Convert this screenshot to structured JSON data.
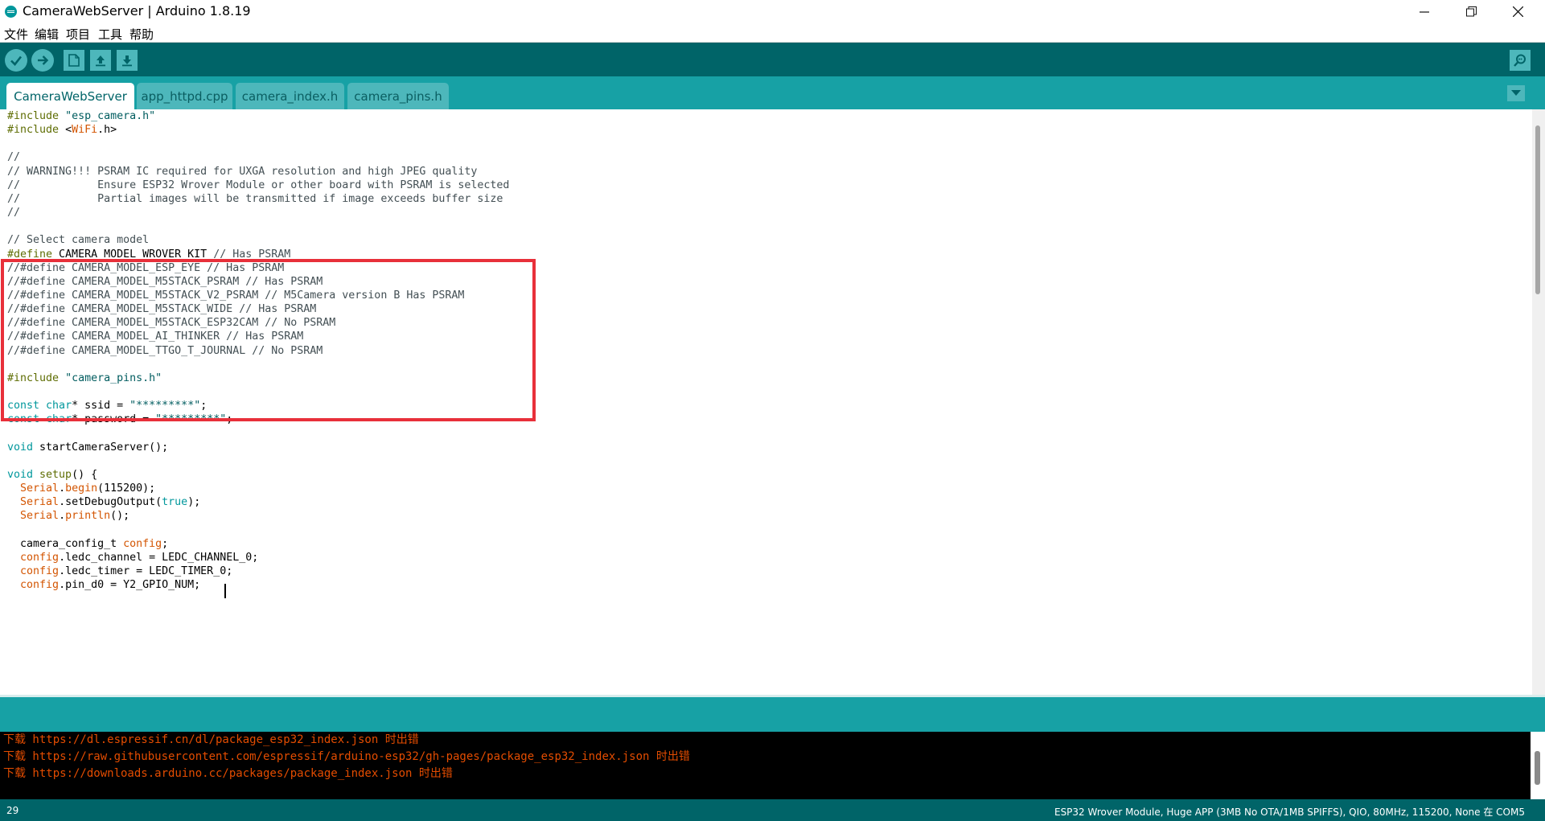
{
  "window": {
    "title": "CameraWebServer | Arduino 1.8.19"
  },
  "menu": {
    "items": [
      "文件",
      "编辑",
      "项目",
      "工具",
      "帮助"
    ]
  },
  "toolbar": {
    "buttons": [
      "verify-icon",
      "upload-icon",
      "new-icon",
      "open-icon",
      "save-icon"
    ],
    "right_button": "serial-monitor-icon"
  },
  "tabs": [
    {
      "label": "CameraWebServer",
      "active": true
    },
    {
      "label": "app_httpd.cpp",
      "active": false
    },
    {
      "label": "camera_index.h",
      "active": false
    },
    {
      "label": "camera_pins.h",
      "active": false
    }
  ],
  "editor": {
    "highlight_color": "#e8303a",
    "lines": [
      [
        [
          "pre",
          "#include "
        ],
        [
          "str",
          "\"esp_camera.h\""
        ]
      ],
      [
        [
          "pre",
          "#include "
        ],
        [
          "plain",
          "<"
        ],
        [
          "kw",
          "WiFi"
        ],
        [
          "plain",
          ".h>"
        ]
      ],
      [],
      [
        [
          "comment",
          "//"
        ]
      ],
      [
        [
          "comment",
          "// WARNING!!! PSRAM IC required for UXGA resolution and high JPEG quality"
        ]
      ],
      [
        [
          "comment",
          "//            Ensure ESP32 Wrover Module or other board with PSRAM is selected"
        ]
      ],
      [
        [
          "comment",
          "//            Partial images will be transmitted if image exceeds buffer size"
        ]
      ],
      [
        [
          "comment",
          "//"
        ]
      ],
      [],
      [
        [
          "comment",
          "// Select camera model"
        ]
      ],
      [
        [
          "pre",
          "#define "
        ],
        [
          "plain",
          "CAMERA_MODEL_WROVER_KIT "
        ],
        [
          "comment",
          "// Has PSRAM"
        ]
      ],
      [
        [
          "comment",
          "//#define CAMERA_MODEL_ESP_EYE // Has PSRAM"
        ]
      ],
      [
        [
          "comment",
          "//#define CAMERA_MODEL_M5STACK_PSRAM // Has PSRAM"
        ]
      ],
      [
        [
          "comment",
          "//#define CAMERA_MODEL_M5STACK_V2_PSRAM // M5Camera version B Has PSRAM"
        ]
      ],
      [
        [
          "comment",
          "//#define CAMERA_MODEL_M5STACK_WIDE // Has PSRAM"
        ]
      ],
      [
        [
          "comment",
          "//#define CAMERA_MODEL_M5STACK_ESP32CAM // No PSRAM"
        ]
      ],
      [
        [
          "comment",
          "//#define CAMERA_MODEL_AI_THINKER // Has PSRAM"
        ]
      ],
      [
        [
          "comment",
          "//#define CAMERA_MODEL_TTGO_T_JOURNAL // No PSRAM"
        ]
      ],
      [],
      [
        [
          "pre",
          "#include "
        ],
        [
          "str",
          "\"camera_pins.h\""
        ]
      ],
      [],
      [
        [
          "type",
          "const "
        ],
        [
          "type",
          "char"
        ],
        [
          "plain",
          "* ssid = "
        ],
        [
          "str",
          "\"*********\""
        ],
        [
          "plain",
          ";"
        ]
      ],
      [
        [
          "type",
          "const "
        ],
        [
          "type",
          "char"
        ],
        [
          "plain",
          "* password = "
        ],
        [
          "str",
          "\"*********\""
        ],
        [
          "plain",
          ";"
        ]
      ],
      [],
      [
        [
          "type",
          "void "
        ],
        [
          "plain",
          "startCameraServer();"
        ]
      ],
      [],
      [
        [
          "type",
          "void "
        ],
        [
          "pre",
          "setup"
        ],
        [
          "plain",
          "() {"
        ]
      ],
      [
        [
          "plain",
          "  "
        ],
        [
          "kw",
          "Serial"
        ],
        [
          "plain",
          "."
        ],
        [
          "kw",
          "begin"
        ],
        [
          "plain",
          "(115200);"
        ]
      ],
      [
        [
          "plain",
          "  "
        ],
        [
          "kw",
          "Serial"
        ],
        [
          "plain",
          ".setDebugOutput("
        ],
        [
          "lit",
          "true"
        ],
        [
          "plain",
          ");"
        ]
      ],
      [
        [
          "plain",
          "  "
        ],
        [
          "kw",
          "Serial"
        ],
        [
          "plain",
          "."
        ],
        [
          "kw",
          "println"
        ],
        [
          "plain",
          "();"
        ]
      ],
      [],
      [
        [
          "plain",
          "  camera_config_t "
        ],
        [
          "kw",
          "config"
        ],
        [
          "plain",
          ";"
        ]
      ],
      [
        [
          "plain",
          "  "
        ],
        [
          "kw",
          "config"
        ],
        [
          "plain",
          ".ledc_channel = LEDC_CHANNEL_0;"
        ]
      ],
      [
        [
          "plain",
          "  "
        ],
        [
          "kw",
          "config"
        ],
        [
          "plain",
          ".ledc_timer = LEDC_TIMER_0;"
        ]
      ],
      [
        [
          "plain",
          "  "
        ],
        [
          "kw",
          "config"
        ],
        [
          "plain",
          ".pin_d0 = Y2_GPIO_NUM;"
        ]
      ]
    ]
  },
  "console": {
    "lines": [
      "下载 https://dl.espressif.cn/dl/package_esp32_index.json 时出错",
      "下载 https://raw.githubusercontent.com/espressif/arduino-esp32/gh-pages/package_esp32_index.json 时出错",
      "下载 https://downloads.arduino.cc/packages/package_index.json 时出错"
    ]
  },
  "status": {
    "line_number": "29",
    "board_info": "ESP32 Wrover Module, Huge APP (3MB No OTA/1MB SPIFFS), QIO, 80MHz, 115200, None 在 COM5"
  }
}
